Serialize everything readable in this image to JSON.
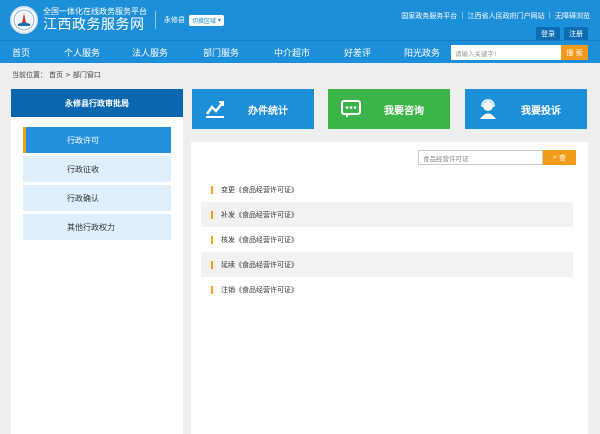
{
  "header": {
    "subtitle": "全国一体化在线政务服务平台",
    "title": "江西政务服务网",
    "county": "永修县",
    "region_switch": "切换区域",
    "links": [
      "国家政务服务平台",
      "江西省人民政府门户网站",
      "无障碍浏览"
    ],
    "login": "登录",
    "register": "注册"
  },
  "nav": {
    "items": [
      "首页",
      "个人服务",
      "法人服务",
      "部门服务",
      "中介超市",
      "好差评",
      "阳光政务"
    ],
    "search_placeholder": "请输入关键字!",
    "search_button": "搜 索"
  },
  "breadcrumb": {
    "prefix": "当前位置：",
    "home": "首页",
    "sep": ">",
    "current": "部门窗口"
  },
  "sidebar": {
    "title": "永修县行政审批局",
    "items": [
      "行政许可",
      "行政征收",
      "行政确认",
      "其他行政权力"
    ]
  },
  "tiles": [
    {
      "label": "办件统计",
      "color": "#1d8fd8",
      "icon": "chart-icon"
    },
    {
      "label": "我要咨询",
      "color": "#3cb44a",
      "icon": "chat-icon"
    },
    {
      "label": "我要投诉",
      "color": "#1d8fd8",
      "icon": "user-complaint-icon"
    }
  ],
  "content": {
    "search_placeholder": "食品经营许可证",
    "search_button": "查",
    "items": [
      "变更《食品经营许可证》",
      "补发《食品经营许可证》",
      "核发《食品经营许可证》",
      "延续《食品经营许可证》",
      "注销《食品经营许可证》"
    ]
  }
}
